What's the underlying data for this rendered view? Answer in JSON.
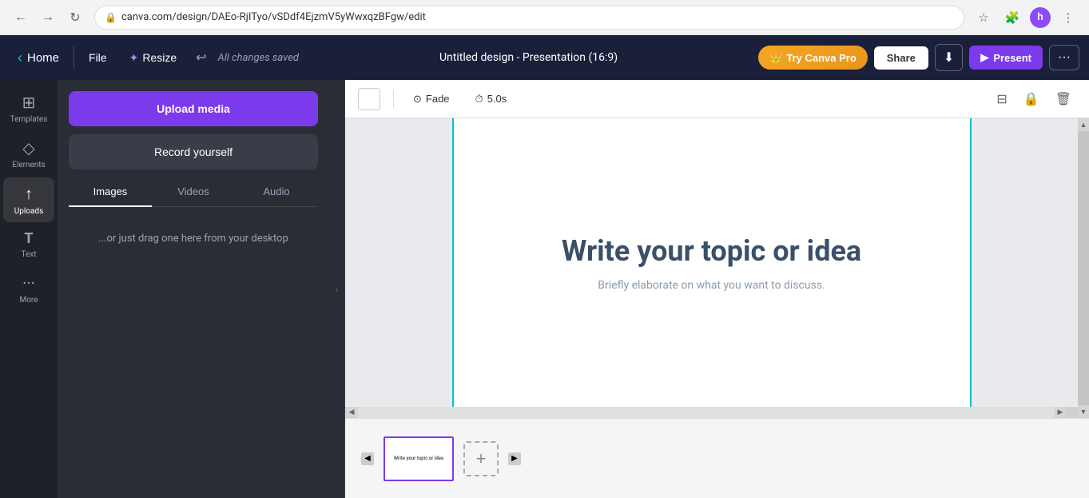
{
  "browser": {
    "url": "canva.com/design/DAEo-RjITyo/vSDdf4EjzmV5yWwxqzBFgw/edit",
    "back_label": "←",
    "forward_label": "→",
    "refresh_label": "↻",
    "star_label": "☆",
    "extension_label": "🧩",
    "user_initial": "h",
    "more_label": "⋮"
  },
  "topbar": {
    "home_label": "Home",
    "home_chevron": "‹",
    "file_label": "File",
    "resize_label": "Resize",
    "resize_icon": "✦",
    "undo_label": "↩",
    "all_changes_saved": "All changes saved",
    "design_title": "Untitled design - Presentation (16:9)",
    "try_pro_label": "Try Canva Pro",
    "crown_icon": "👑",
    "share_label": "Share",
    "download_icon": "⬇",
    "present_label": "Present",
    "present_icon": "▶",
    "more_label": "···"
  },
  "sidebar": {
    "items": [
      {
        "id": "templates",
        "icon": "⊞",
        "label": "Templates"
      },
      {
        "id": "elements",
        "icon": "◇",
        "label": "Elements"
      },
      {
        "id": "uploads",
        "icon": "↑",
        "label": "Uploads"
      },
      {
        "id": "text",
        "icon": "T",
        "label": "Text"
      },
      {
        "id": "more",
        "icon": "···",
        "label": "More"
      }
    ]
  },
  "upload_panel": {
    "upload_media_label": "Upload media",
    "record_label": "Record yourself",
    "tabs": [
      {
        "id": "images",
        "label": "Images"
      },
      {
        "id": "videos",
        "label": "Videos"
      },
      {
        "id": "audio",
        "label": "Audio"
      }
    ],
    "drag_hint": "...or just drag one here from your desktop"
  },
  "canvas_toolbar": {
    "fade_label": "Fade",
    "fade_icon": "⊙",
    "duration_label": "5.0s",
    "duration_icon": "⏱",
    "tools": {
      "layout_icon": "⊟",
      "lock_icon": "🔒",
      "delete_icon": "🗑"
    }
  },
  "slide": {
    "title": "Write your topic or idea",
    "subtitle": "Briefly elaborate on what you want to discuss."
  },
  "thumbnails": [
    {
      "id": "slide1",
      "text": "Write your topic or idea"
    }
  ],
  "add_slide_label": "+",
  "collapse_icon": "‹"
}
